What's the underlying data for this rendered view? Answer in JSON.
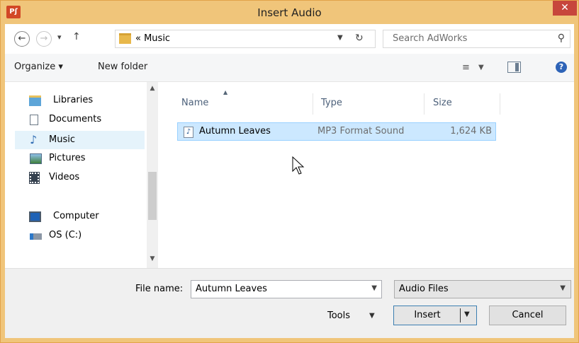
{
  "app": {
    "icon_label": "Pʃ",
    "title": "Insert Audio",
    "close_label": "✕"
  },
  "address": {
    "path": "«  Music",
    "search_placeholder": "Search AdWorks"
  },
  "toolbar": {
    "organize": "Organize ▾",
    "new_folder": "New folder"
  },
  "nav": {
    "items": [
      {
        "label": "Libraries",
        "icon": "libraries-icon"
      },
      {
        "label": "Documents",
        "icon": "documents-icon"
      },
      {
        "label": "Music",
        "icon": "music-icon",
        "selected": true
      },
      {
        "label": "Pictures",
        "icon": "pictures-icon"
      },
      {
        "label": "Videos",
        "icon": "videos-icon"
      },
      {
        "label": "Computer",
        "icon": "computer-icon"
      },
      {
        "label": "OS (C:)",
        "icon": "drive-icon"
      }
    ]
  },
  "files": {
    "columns": {
      "name": "Name",
      "type": "Type",
      "size": "Size"
    },
    "rows": [
      {
        "name": "Autumn Leaves",
        "type": "MP3 Format Sound",
        "size": "1,624 KB"
      }
    ]
  },
  "footer": {
    "filename_label": "File name:",
    "filename_value": "Autumn Leaves",
    "filter_value": "Audio Files",
    "tools_label": "Tools",
    "insert_label": "Insert",
    "cancel_label": "Cancel"
  },
  "colors": {
    "title_bg": "#f0c57a",
    "close": "#c7463c",
    "selection": "#cce8ff",
    "accent": "#3c7fb1"
  }
}
